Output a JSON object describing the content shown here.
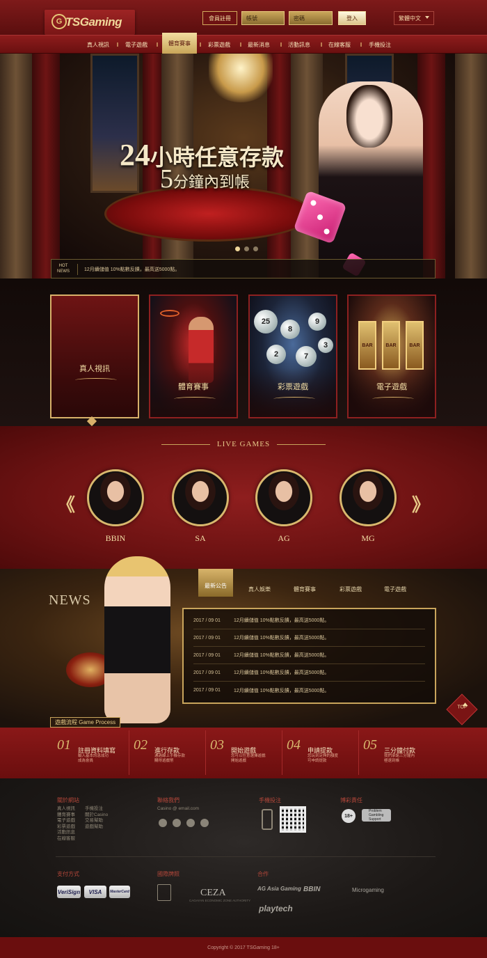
{
  "header": {
    "logo_text": "TSGaming",
    "logo_mark": "G",
    "register_label": "會員註冊",
    "account_placeholder": "帳號",
    "password_placeholder": "密碼",
    "login_label": "登入",
    "language": "繁體中文"
  },
  "nav": {
    "items": [
      {
        "label": "真人視訊"
      },
      {
        "label": "電子遊戲"
      },
      {
        "label": "體育賽事",
        "active": true
      },
      {
        "label": "彩票遊戲"
      },
      {
        "label": "最新消息"
      },
      {
        "label": "活動訊息"
      },
      {
        "label": "在線客服"
      },
      {
        "label": "手機投注"
      }
    ]
  },
  "hero": {
    "line1_num": "24",
    "line1_text": "小時任意存款",
    "line2_num": "5",
    "line2_text": "分鐘內到帳",
    "slide_count": 3,
    "active_slide": 0
  },
  "hot_news": {
    "label_line1": "HOT",
    "label_line2": "NEWS",
    "text": "12月續儲值 10%點數反饋，最高送5000點。"
  },
  "categories": [
    {
      "label": "真人視訊"
    },
    {
      "label": "體育賽事"
    },
    {
      "label": "彩票遊戲"
    },
    {
      "label": "電子遊戲"
    }
  ],
  "lottery_balls": [
    "25",
    "8",
    "9",
    "2",
    "7",
    "3"
  ],
  "slot_reels": [
    "BAR",
    "BAR",
    "BAR"
  ],
  "live_games": {
    "title": "LIVE GAMES",
    "prev_arrow": "《",
    "next_arrow": "》",
    "providers": [
      {
        "name": "BBIN"
      },
      {
        "name": "SA"
      },
      {
        "name": "AG"
      },
      {
        "name": "MG"
      }
    ]
  },
  "news": {
    "title": "NEWS",
    "tabs": [
      "最新公告",
      "真人娛樂",
      "體育賽事",
      "彩票遊戲",
      "電子遊戲"
    ],
    "rows": [
      {
        "date": "2017 / 09 01",
        "text": "12月續儲值 10%點數反饋，最高送5000點。"
      },
      {
        "date": "2017 / 09 01",
        "text": "12月續儲值 10%點數反饋，最高送5000點。"
      },
      {
        "date": "2017 / 09 01",
        "text": "12月續儲值 10%點數反饋，最高送5000點。"
      },
      {
        "date": "2017 / 09 01",
        "text": "12月續儲值 10%點數反饋，最高送5000點。"
      },
      {
        "date": "2017 / 09 01",
        "text": "12月續儲值 10%點數反饋，最高送5000點。"
      }
    ],
    "top_label": "TOP"
  },
  "process": {
    "label": "遊戲流程 Game Process",
    "steps": [
      {
        "num": "01",
        "title": "註冊資料填寫",
        "desc1": "輸入基本訊息成功",
        "desc2": "成為會員"
      },
      {
        "num": "02",
        "title": "進行存款",
        "desc1": "通過線上手機存款",
        "desc2": "購得遊戲幣"
      },
      {
        "num": "03",
        "title": "開始遊戲",
        "desc1": "您可以任意選擇遊戲",
        "desc2": "開始遊戲"
      },
      {
        "num": "04",
        "title": "申請提款",
        "desc1": "您玩到足夠的額度",
        "desc2": "可申請提款"
      },
      {
        "num": "05",
        "title": "三分鐘付款",
        "desc1": "我們承諾三分鐘內",
        "desc2": "極速到帳"
      }
    ]
  },
  "footer": {
    "about_heading": "關於網站",
    "about_col1": [
      "真人視訊",
      "體育賽事",
      "電子遊戲",
      "彩票遊戲",
      "活動訊息",
      "在線客服"
    ],
    "about_col2": [
      "手機投注",
      "關於Casino",
      "交易幫助",
      "遊戲幫助"
    ],
    "contact_heading": "聯絡我們",
    "contact_email": "Casino @ email.com",
    "mobile_heading": "手機投注",
    "responsible_heading": "博彩責任",
    "age_badge": "18+",
    "pgs_line1": "Problem",
    "pgs_line2": "Gambling",
    "pgs_line3": "Support",
    "payment_heading": "支付方式",
    "payments": [
      "VeriSign",
      "VISA",
      "MasterCard"
    ],
    "license_heading": "國際牌照",
    "ceza": "CEZA",
    "ceza_sub": "CAGAYAN ECONOMIC ZONE AUTHORITY",
    "partners_heading": "合作",
    "partners": [
      "AG Asia Gaming",
      "BBIN",
      "Microgaming",
      "playtech"
    ],
    "copyright": "Copyright © 2017 TSGaming 18+"
  }
}
